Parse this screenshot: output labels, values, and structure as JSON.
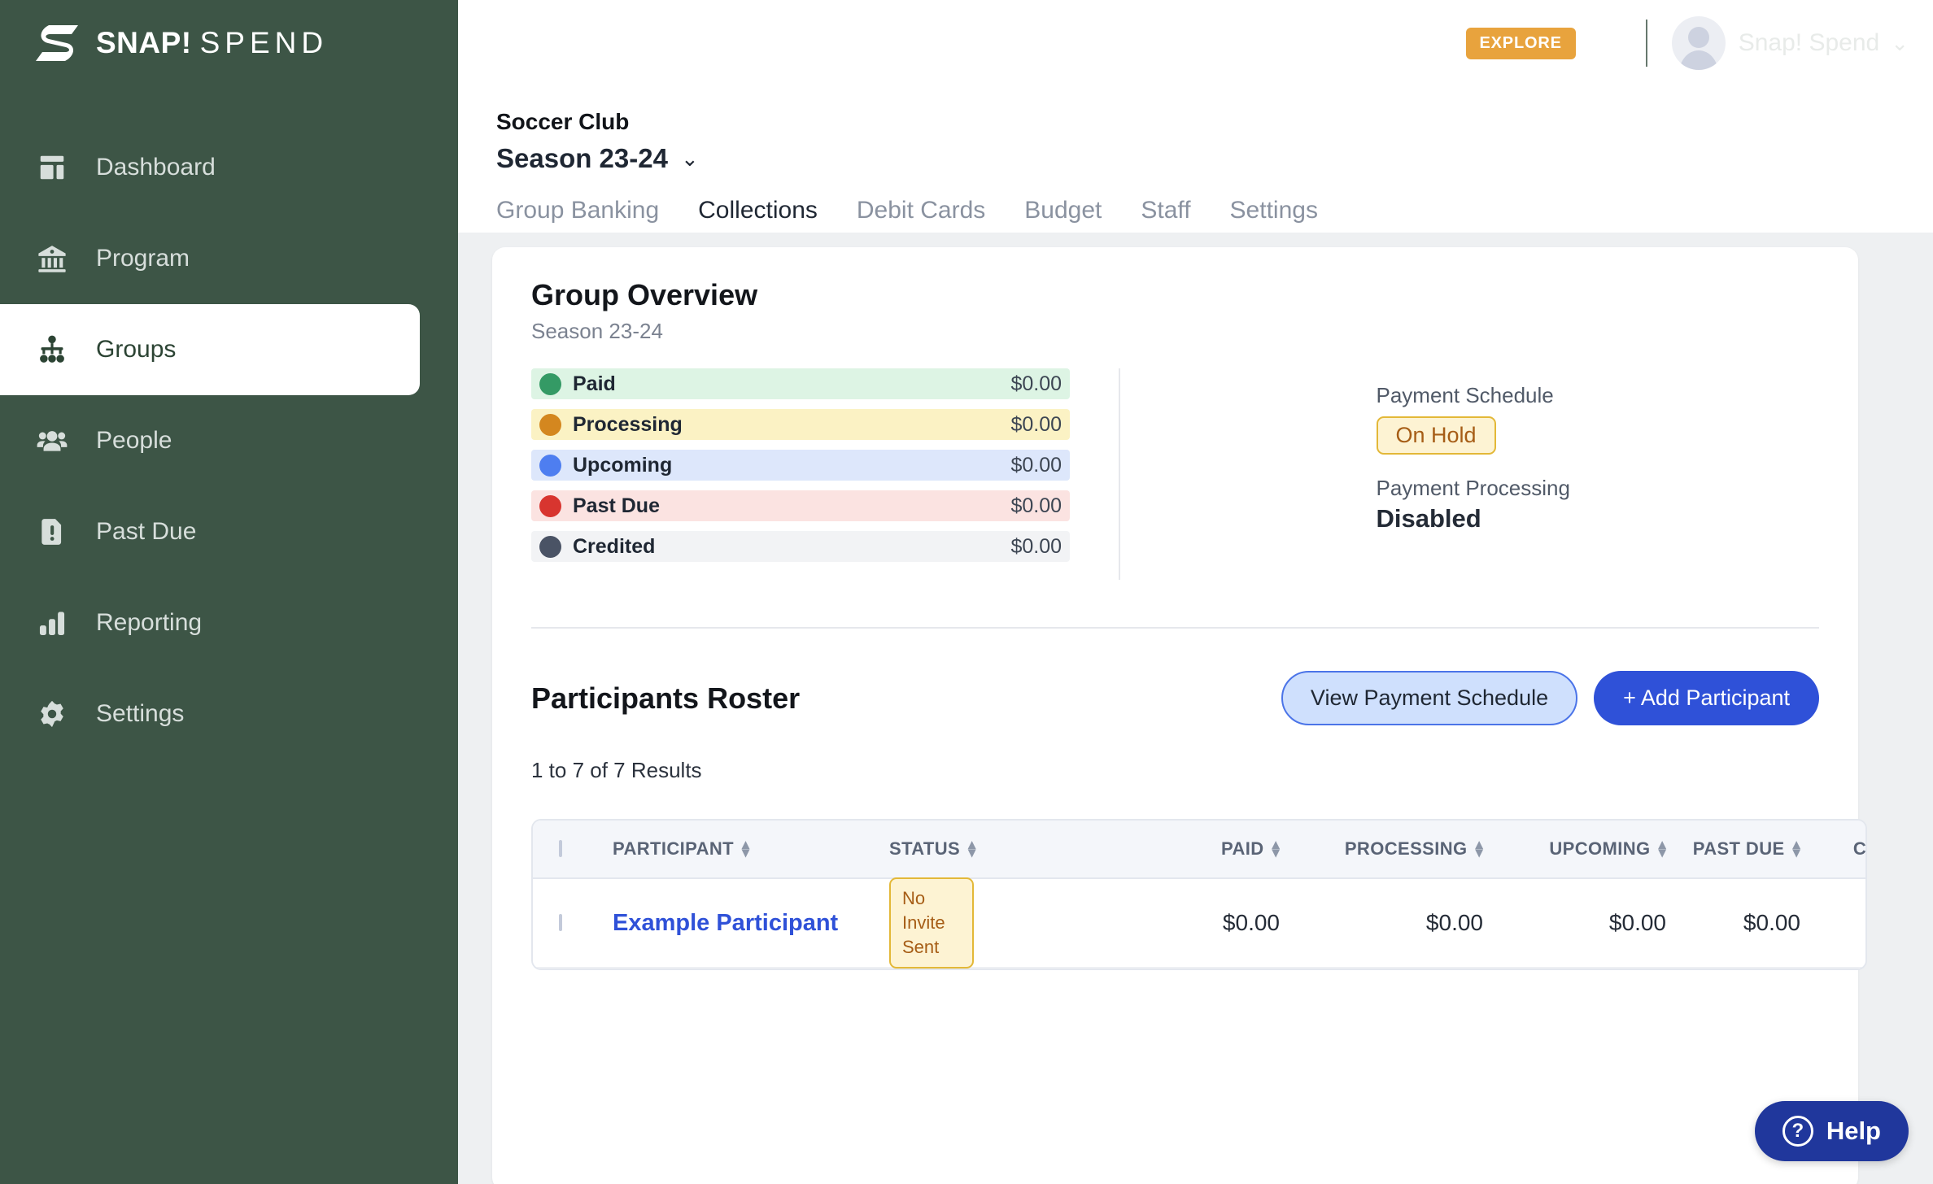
{
  "brand": {
    "name_bold": "SNAP!",
    "name_thin": "SPEND",
    "logo_icon": "snap-logo-icon"
  },
  "topbar": {
    "explore_label": "EXPLORE",
    "grid_icon": "apps-grid-icon",
    "avatar_icon": "user-avatar-icon",
    "user_name": "Snap! Spend",
    "caret_icon": "chevron-down-icon"
  },
  "sidebar": {
    "items": [
      {
        "label": "Dashboard",
        "icon": "dashboard-icon",
        "active": false
      },
      {
        "label": "Program",
        "icon": "bank-icon",
        "active": false
      },
      {
        "label": "Groups",
        "icon": "org-chart-icon",
        "active": true
      },
      {
        "label": "People",
        "icon": "people-icon",
        "active": false
      },
      {
        "label": "Past Due",
        "icon": "alert-file-icon",
        "active": false
      },
      {
        "label": "Reporting",
        "icon": "bar-chart-icon",
        "active": false
      },
      {
        "label": "Settings",
        "icon": "gear-icon",
        "active": false
      }
    ]
  },
  "page": {
    "club_name": "Soccer Club",
    "season": "Season 23-24",
    "season_caret": "chevron-down-icon",
    "tabs": [
      {
        "label": "Group Banking",
        "active": false
      },
      {
        "label": "Collections",
        "active": true
      },
      {
        "label": "Debit Cards",
        "active": false
      },
      {
        "label": "Budget",
        "active": false
      },
      {
        "label": "Staff",
        "active": false
      },
      {
        "label": "Settings",
        "active": false
      }
    ]
  },
  "overview": {
    "title": "Group Overview",
    "subtitle": "Season 23-24",
    "rows": [
      {
        "label": "Paid",
        "amount": "$0.00",
        "dot": "#349a65",
        "bg": "#ddf4e4"
      },
      {
        "label": "Processing",
        "amount": "$0.00",
        "dot": "#d4871f",
        "bg": "#fbf2c4"
      },
      {
        "label": "Upcoming",
        "amount": "$0.00",
        "dot": "#4e7ef0",
        "bg": "#dde7fb"
      },
      {
        "label": "Past Due",
        "amount": "$0.00",
        "dot": "#d8352f",
        "bg": "#fbe3e1"
      },
      {
        "label": "Credited",
        "amount": "$0.00",
        "dot": "#4a5365",
        "bg": "#f2f3f5"
      }
    ],
    "payment_schedule_label": "Payment Schedule",
    "payment_schedule_status": "On Hold",
    "payment_processing_label": "Payment Processing",
    "payment_processing_value": "Disabled"
  },
  "roster": {
    "title": "Participants Roster",
    "view_schedule_label": "View Payment Schedule",
    "add_participant_label": "+ Add Participant",
    "results_text": "1 to 7 of 7 Results",
    "columns": [
      {
        "label": "PARTICIPANT",
        "sortable": true
      },
      {
        "label": "STATUS",
        "sortable": true
      },
      {
        "label": "PAID",
        "sortable": true
      },
      {
        "label": "PROCESSING",
        "sortable": true
      },
      {
        "label": "UPCOMING",
        "sortable": true
      },
      {
        "label": "PAST DUE",
        "sortable": true
      },
      {
        "label": "CREDITED",
        "sortable": true
      }
    ],
    "rows": [
      {
        "participant": "Example Participant",
        "status": "No Invite Sent",
        "paid": "$0.00",
        "processing": "$0.00",
        "upcoming": "$0.00",
        "past_due": "$0.00",
        "credited": ""
      }
    ]
  },
  "help": {
    "label": "Help",
    "icon": "question-circle-icon",
    "glyph": "?"
  },
  "colors": {
    "sidebar_bg": "#3d5546",
    "accent_orange": "#e8a33d",
    "primary_blue": "#2f51d8",
    "help_blue": "#20379c",
    "page_bg": "#eef0f2"
  }
}
